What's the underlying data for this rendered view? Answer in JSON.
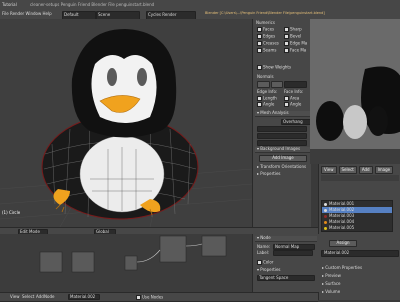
{
  "window": {
    "title": "Blender  [C:\\Users\\...\\Penguin Friend\\Blender File\\penguinstart.blend]",
    "titlebar_left": "Tutorial"
  },
  "topbar": {
    "layout": "Default",
    "scene": "Scene",
    "engine": "Cycles Render",
    "address": "cleaner-setups Penguin Friend Blender File penguinstart.blend"
  },
  "viewport": {
    "label": "(1) Circle",
    "mode": "Edit Mode",
    "global": "Global"
  },
  "props_panel": {
    "header": "Numerics",
    "faces_label": "Faces",
    "items_left": [
      "Faces",
      "Edges",
      "Creases",
      "Seams"
    ],
    "items_right": [
      "Sharp",
      "Bevel",
      "Edge Ma",
      "Face Ma"
    ],
    "show_weights": "Show Weights",
    "normals_header": "Normals",
    "edge_info": "Edge Info:",
    "face_info": "Face Info:",
    "length": "Length",
    "angle": "Angle",
    "area": "Area",
    "mesh_analysis": "Mesh Analysis",
    "overhang": "Overhang",
    "background_images": "Background Images",
    "add_image": "Add Image",
    "transform_orientations": "Transform Orientations",
    "properties": "Properties"
  },
  "right_panel": {
    "tabs": [
      "View",
      "Select",
      "Add",
      "Image"
    ],
    "materials": [
      "Material.001",
      "Material.002",
      "Material.003",
      "Material.004",
      "Material.005"
    ],
    "material_colors": [
      "#dddddd",
      "#d8d8d8",
      "#8b2a2a",
      "#e08a1a",
      "#e0c21a"
    ],
    "selected_index": 1,
    "assign": "Assign",
    "current_material": "Material.002",
    "sections": [
      "Custom Properties",
      "Preview",
      "Surface",
      "Volume"
    ]
  },
  "node_panel": {
    "header": "Node",
    "name_label": "Name:",
    "name_value": "Normal Map",
    "label_label": "Label:",
    "color": "Color",
    "properties": "Properties",
    "tangent": "Tangent Space"
  },
  "bottom_bar": {
    "material": "Material.002",
    "use_nodes": "Use Nodes",
    "view": "View",
    "select": "Select",
    "add": "Add",
    "node": "Node"
  }
}
